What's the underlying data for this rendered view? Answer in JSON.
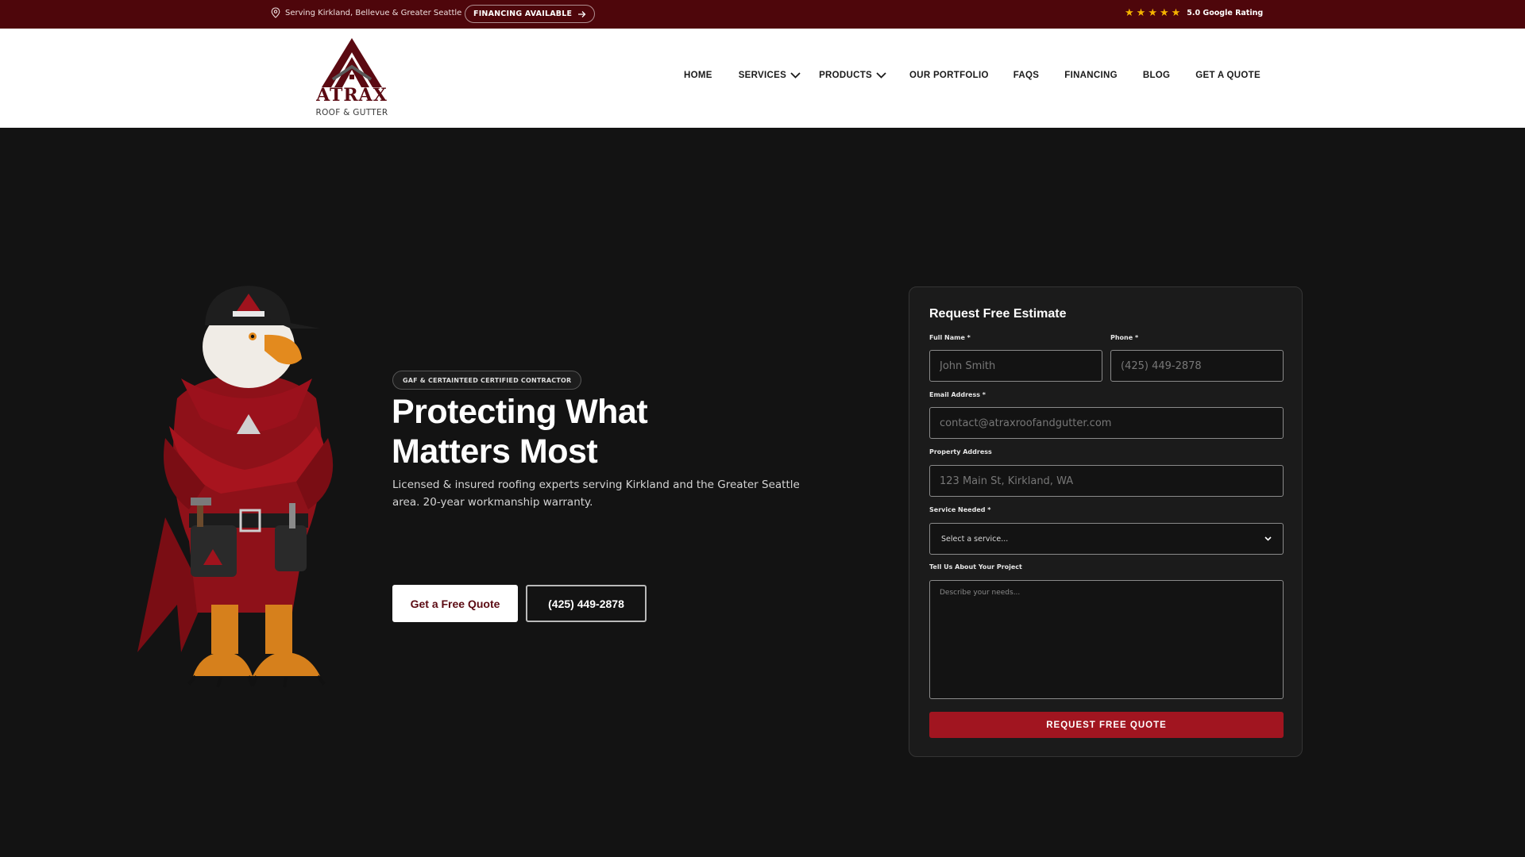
{
  "topbar": {
    "location": "Serving Kirkland, Bellevue & Greater Seattle",
    "financing_label": "FINANCING AVAILABLE",
    "rating": "5.0 Google Rating",
    "stars": [
      "★",
      "★",
      "★",
      "★",
      "★"
    ],
    "star_color": "#f5b400",
    "bg_color": "#4e060b"
  },
  "logo": {
    "wordmark": "ATRAX",
    "tagline": "ROOF & GUTTER"
  },
  "nav": {
    "items": [
      {
        "label": "HOME",
        "dropdown": false
      },
      {
        "label": "SERVICES",
        "dropdown": true
      },
      {
        "label": "PRODUCTS",
        "dropdown": true
      },
      {
        "label": "OUR PORTFOLIO",
        "dropdown": false
      },
      {
        "label": "FAQS",
        "dropdown": false
      },
      {
        "label": "FINANCING",
        "dropdown": false
      },
      {
        "label": "BLOG",
        "dropdown": false
      },
      {
        "label": "GET A QUOTE",
        "dropdown": false
      }
    ]
  },
  "hero": {
    "badge": "GAF & CERTAINTEED CERTIFIED CONTRACTOR",
    "headline_line1": "Protecting What",
    "headline_line2": "Matters Most",
    "subtext": "Licensed & insured roofing experts serving Kirkland and the Greater Seattle area. 20-year workmanship warranty.",
    "cta_primary": "Get a Free Quote",
    "cta_phone": "(425) 449-2878"
  },
  "form": {
    "title": "Request Free Estimate",
    "full_name_label": "Full Name *",
    "full_name_placeholder": "John Smith",
    "phone_label": "Phone *",
    "phone_placeholder": "(425) 449-2878",
    "email_label": "Email Address *",
    "email_placeholder": "contact@atraxroofandgutter.com",
    "address_label": "Property Address",
    "address_placeholder": "123 Main St, Kirkland, WA",
    "service_label": "Service Needed *",
    "service_selected": "Select a service...",
    "project_label": "Tell Us About Your Project",
    "project_placeholder": "Describe your needs...",
    "submit_label": "REQUEST FREE QUOTE",
    "accent_color": "#a11520"
  }
}
